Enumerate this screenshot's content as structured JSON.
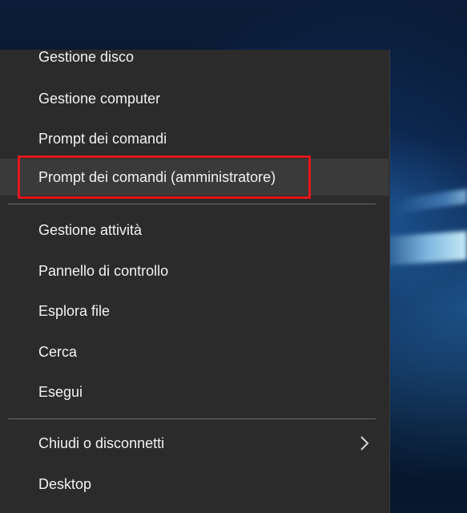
{
  "menu": {
    "items": [
      {
        "label": "Gestione disco"
      },
      {
        "label": "Gestione computer"
      },
      {
        "label": "Prompt dei comandi"
      },
      {
        "label": "Prompt dei comandi (amministratore)"
      },
      {
        "label": "Gestione attività"
      },
      {
        "label": "Pannello di controllo"
      },
      {
        "label": "Esplora file"
      },
      {
        "label": "Cerca"
      },
      {
        "label": "Esegui"
      },
      {
        "label": "Chiudi o disconnetti"
      },
      {
        "label": "Desktop"
      }
    ]
  },
  "colors": {
    "menu_background": "#2b2b2b",
    "hover_background": "#3a3a3a",
    "highlight_border": "#e2161b",
    "text": "#f2f2f2"
  },
  "icons": {
    "submenu_arrow": "chevron-right-icon"
  }
}
